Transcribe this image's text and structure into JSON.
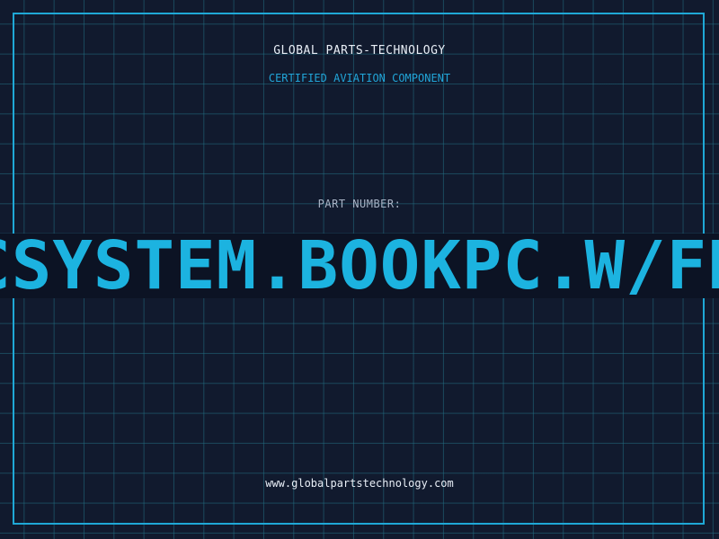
{
  "brand": {
    "company": "GLOBAL PARTS-TECHNOLOGY",
    "subtitle": "CERTIFIED AVIATION COMPONENT"
  },
  "part": {
    "label": "PART NUMBER:",
    "value": "CSYSTEM.BOOKPC.W/FD"
  },
  "footer": {
    "website": "www.globalpartstechnology.com"
  },
  "colors": {
    "background": "#111a2e",
    "grid": "#226e82",
    "accent": "#1cb3e0",
    "text": "#e8eef6",
    "muted": "#a9b4c6"
  }
}
